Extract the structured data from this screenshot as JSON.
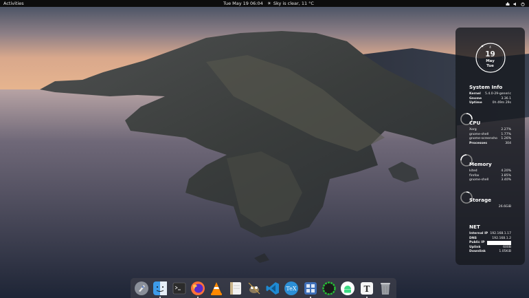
{
  "topbar": {
    "activities": "Activities",
    "clock": "Tue May 19  06:04",
    "weather": "Sky is clear, 11 °C"
  },
  "conky": {
    "calendar": {
      "small": "4",
      "day": "19",
      "month": "May",
      "weekday": "Tue"
    },
    "system": {
      "title": "System Info",
      "rows": [
        {
          "k": "Kernel",
          "v": "5.4.0-29-generic"
        },
        {
          "k": "Gnome",
          "v": "3.36.1"
        },
        {
          "k": "Uptime",
          "v": "0h 49m 29s"
        }
      ]
    },
    "cpu": {
      "title": "CPU",
      "rows": [
        {
          "k": "Xorg",
          "v": "2.27%"
        },
        {
          "k": "gnome-shell",
          "v": "1.77%"
        },
        {
          "k": "gnome-screensho",
          "v": "1.26%"
        }
      ],
      "processes_label": "Processes",
      "processes": "304"
    },
    "memory": {
      "title": "Memory",
      "rows": [
        {
          "k": "kited",
          "v": "4.20%"
        },
        {
          "k": "firefox",
          "v": "3.85%"
        },
        {
          "k": "gnome-shell",
          "v": "3.40%"
        }
      ]
    },
    "storage": {
      "title": "Storage",
      "value": "26.6GiB"
    },
    "net": {
      "title": "NET",
      "rows": [
        {
          "k": "Internal IP",
          "v": "192.168.1.17"
        },
        {
          "k": "DNS",
          "v": "192.168.1.2"
        },
        {
          "k": "Public IP",
          "v": ""
        },
        {
          "k": "Uplink",
          "v": "600B"
        },
        {
          "k": "Downlink",
          "v": "1.05KiB"
        }
      ]
    }
  },
  "dock": {
    "items": [
      {
        "icon": "launchpad-icon",
        "running": false
      },
      {
        "icon": "finder-icon",
        "running": true
      },
      {
        "icon": "terminal-icon",
        "running": false
      },
      {
        "icon": "firefox-icon",
        "running": true
      },
      {
        "icon": "vlc-icon",
        "running": false
      },
      {
        "icon": "notes-icon",
        "running": false
      },
      {
        "icon": "gimp-icon",
        "running": false
      },
      {
        "icon": "vscode-icon",
        "running": false
      },
      {
        "icon": "tex-icon",
        "running": false
      },
      {
        "icon": "tweaks-icon",
        "running": true
      },
      {
        "icon": "progress-icon",
        "running": false
      },
      {
        "icon": "android-icon",
        "running": false
      },
      {
        "icon": "typora-icon",
        "running": true
      },
      {
        "icon": "trash-icon",
        "running": false
      }
    ]
  },
  "colors": {
    "accent": "#ffffff",
    "panel": "#16181e",
    "topbar": "#0d0d0d"
  }
}
